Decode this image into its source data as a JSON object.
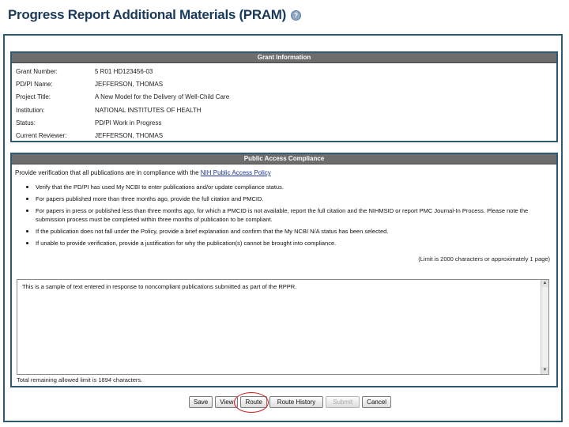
{
  "page": {
    "title": "Progress Report Additional Materials (PRAM)",
    "help_icon": "question-mark-icon"
  },
  "grant_info": {
    "header": "Grant Information",
    "rows": [
      {
        "label": "Grant Number:",
        "value": "5 R01 HD123456-03"
      },
      {
        "label": "PD/PI Name:",
        "value": "JEFFERSON, THOMAS"
      },
      {
        "label": "Project Title:",
        "value": "A New Model for the Delivery of Well-Child Care"
      },
      {
        "label": "Institution:",
        "value": "NATIONAL INSTITUTES OF HEALTH"
      },
      {
        "label": "Status:",
        "value": "PD/PI Work in Progress"
      },
      {
        "label": "Current Reviewer:",
        "value": "JEFFERSON, THOMAS"
      }
    ]
  },
  "public_access": {
    "header": "Public Access Compliance",
    "intro": "Provide verification that all publications are in compliance with the ",
    "policy_link": "NIH Public Access Policy",
    "bullets": [
      "Verify that the PD/PI has used My NCBI to enter publications and/or update compliance status.",
      "For papers published more than three months ago, provide the full citation and PMCID.",
      "For papers in press or published less than three months ago, for which a PMCID is not available, report the full citation and the NIHMSID or report PMC Journal-In Process. Please note the submission process must be completed within three months of publication to be compliant.",
      "If the publication does not fall under the Policy, provide a brief explanation and confirm that the My NCBI N/A status has been selected.",
      "If unable to provide verification, provide a justification for why the publication(s) cannot be brought into compliance."
    ],
    "limit_note": "(Limit is 2000 characters or approximately 1 page)",
    "response_text": "This is a sample of text entered in response to noncompliant publications submitted as part of the RPPR.",
    "remaining": "Total remaining allowed limit is 1894 characters."
  },
  "buttons": {
    "save": "Save",
    "view": "View",
    "route": "Route",
    "route_history": "Route History",
    "submit": "Submit",
    "cancel": "Cancel"
  },
  "colors": {
    "frame_border": "#2c5a72",
    "section_header_bg": "#6d6d6d",
    "highlight_circle": "#cc1a1a"
  }
}
